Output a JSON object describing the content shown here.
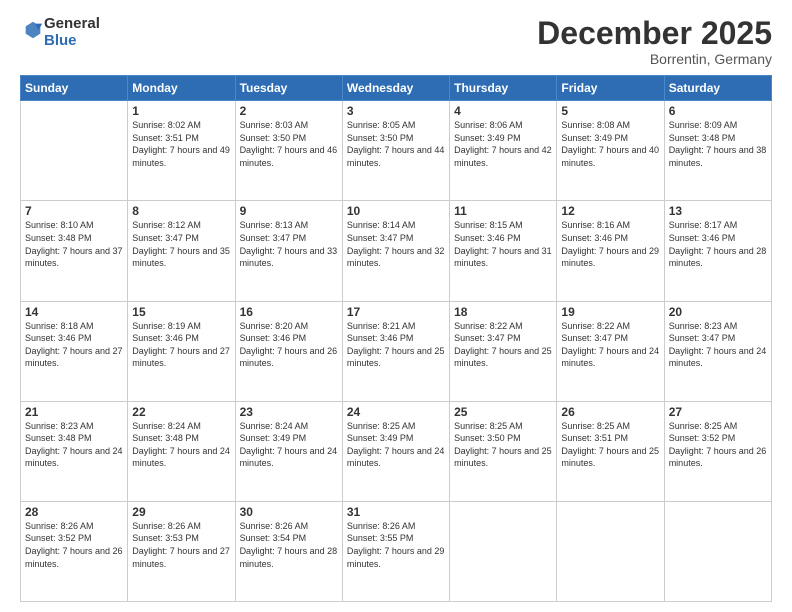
{
  "logo": {
    "general": "General",
    "blue": "Blue"
  },
  "header": {
    "month": "December 2025",
    "location": "Borrentin, Germany"
  },
  "weekdays": [
    "Sunday",
    "Monday",
    "Tuesday",
    "Wednesday",
    "Thursday",
    "Friday",
    "Saturday"
  ],
  "weeks": [
    [
      {
        "day": "",
        "sunrise": "",
        "sunset": "",
        "daylight": ""
      },
      {
        "day": "1",
        "sunrise": "Sunrise: 8:02 AM",
        "sunset": "Sunset: 3:51 PM",
        "daylight": "Daylight: 7 hours and 49 minutes."
      },
      {
        "day": "2",
        "sunrise": "Sunrise: 8:03 AM",
        "sunset": "Sunset: 3:50 PM",
        "daylight": "Daylight: 7 hours and 46 minutes."
      },
      {
        "day": "3",
        "sunrise": "Sunrise: 8:05 AM",
        "sunset": "Sunset: 3:50 PM",
        "daylight": "Daylight: 7 hours and 44 minutes."
      },
      {
        "day": "4",
        "sunrise": "Sunrise: 8:06 AM",
        "sunset": "Sunset: 3:49 PM",
        "daylight": "Daylight: 7 hours and 42 minutes."
      },
      {
        "day": "5",
        "sunrise": "Sunrise: 8:08 AM",
        "sunset": "Sunset: 3:49 PM",
        "daylight": "Daylight: 7 hours and 40 minutes."
      },
      {
        "day": "6",
        "sunrise": "Sunrise: 8:09 AM",
        "sunset": "Sunset: 3:48 PM",
        "daylight": "Daylight: 7 hours and 38 minutes."
      }
    ],
    [
      {
        "day": "7",
        "sunrise": "Sunrise: 8:10 AM",
        "sunset": "Sunset: 3:48 PM",
        "daylight": "Daylight: 7 hours and 37 minutes."
      },
      {
        "day": "8",
        "sunrise": "Sunrise: 8:12 AM",
        "sunset": "Sunset: 3:47 PM",
        "daylight": "Daylight: 7 hours and 35 minutes."
      },
      {
        "day": "9",
        "sunrise": "Sunrise: 8:13 AM",
        "sunset": "Sunset: 3:47 PM",
        "daylight": "Daylight: 7 hours and 33 minutes."
      },
      {
        "day": "10",
        "sunrise": "Sunrise: 8:14 AM",
        "sunset": "Sunset: 3:47 PM",
        "daylight": "Daylight: 7 hours and 32 minutes."
      },
      {
        "day": "11",
        "sunrise": "Sunrise: 8:15 AM",
        "sunset": "Sunset: 3:46 PM",
        "daylight": "Daylight: 7 hours and 31 minutes."
      },
      {
        "day": "12",
        "sunrise": "Sunrise: 8:16 AM",
        "sunset": "Sunset: 3:46 PM",
        "daylight": "Daylight: 7 hours and 29 minutes."
      },
      {
        "day": "13",
        "sunrise": "Sunrise: 8:17 AM",
        "sunset": "Sunset: 3:46 PM",
        "daylight": "Daylight: 7 hours and 28 minutes."
      }
    ],
    [
      {
        "day": "14",
        "sunrise": "Sunrise: 8:18 AM",
        "sunset": "Sunset: 3:46 PM",
        "daylight": "Daylight: 7 hours and 27 minutes."
      },
      {
        "day": "15",
        "sunrise": "Sunrise: 8:19 AM",
        "sunset": "Sunset: 3:46 PM",
        "daylight": "Daylight: 7 hours and 27 minutes."
      },
      {
        "day": "16",
        "sunrise": "Sunrise: 8:20 AM",
        "sunset": "Sunset: 3:46 PM",
        "daylight": "Daylight: 7 hours and 26 minutes."
      },
      {
        "day": "17",
        "sunrise": "Sunrise: 8:21 AM",
        "sunset": "Sunset: 3:46 PM",
        "daylight": "Daylight: 7 hours and 25 minutes."
      },
      {
        "day": "18",
        "sunrise": "Sunrise: 8:22 AM",
        "sunset": "Sunset: 3:47 PM",
        "daylight": "Daylight: 7 hours and 25 minutes."
      },
      {
        "day": "19",
        "sunrise": "Sunrise: 8:22 AM",
        "sunset": "Sunset: 3:47 PM",
        "daylight": "Daylight: 7 hours and 24 minutes."
      },
      {
        "day": "20",
        "sunrise": "Sunrise: 8:23 AM",
        "sunset": "Sunset: 3:47 PM",
        "daylight": "Daylight: 7 hours and 24 minutes."
      }
    ],
    [
      {
        "day": "21",
        "sunrise": "Sunrise: 8:23 AM",
        "sunset": "Sunset: 3:48 PM",
        "daylight": "Daylight: 7 hours and 24 minutes."
      },
      {
        "day": "22",
        "sunrise": "Sunrise: 8:24 AM",
        "sunset": "Sunset: 3:48 PM",
        "daylight": "Daylight: 7 hours and 24 minutes."
      },
      {
        "day": "23",
        "sunrise": "Sunrise: 8:24 AM",
        "sunset": "Sunset: 3:49 PM",
        "daylight": "Daylight: 7 hours and 24 minutes."
      },
      {
        "day": "24",
        "sunrise": "Sunrise: 8:25 AM",
        "sunset": "Sunset: 3:49 PM",
        "daylight": "Daylight: 7 hours and 24 minutes."
      },
      {
        "day": "25",
        "sunrise": "Sunrise: 8:25 AM",
        "sunset": "Sunset: 3:50 PM",
        "daylight": "Daylight: 7 hours and 25 minutes."
      },
      {
        "day": "26",
        "sunrise": "Sunrise: 8:25 AM",
        "sunset": "Sunset: 3:51 PM",
        "daylight": "Daylight: 7 hours and 25 minutes."
      },
      {
        "day": "27",
        "sunrise": "Sunrise: 8:25 AM",
        "sunset": "Sunset: 3:52 PM",
        "daylight": "Daylight: 7 hours and 26 minutes."
      }
    ],
    [
      {
        "day": "28",
        "sunrise": "Sunrise: 8:26 AM",
        "sunset": "Sunset: 3:52 PM",
        "daylight": "Daylight: 7 hours and 26 minutes."
      },
      {
        "day": "29",
        "sunrise": "Sunrise: 8:26 AM",
        "sunset": "Sunset: 3:53 PM",
        "daylight": "Daylight: 7 hours and 27 minutes."
      },
      {
        "day": "30",
        "sunrise": "Sunrise: 8:26 AM",
        "sunset": "Sunset: 3:54 PM",
        "daylight": "Daylight: 7 hours and 28 minutes."
      },
      {
        "day": "31",
        "sunrise": "Sunrise: 8:26 AM",
        "sunset": "Sunset: 3:55 PM",
        "daylight": "Daylight: 7 hours and 29 minutes."
      },
      {
        "day": "",
        "sunrise": "",
        "sunset": "",
        "daylight": ""
      },
      {
        "day": "",
        "sunrise": "",
        "sunset": "",
        "daylight": ""
      },
      {
        "day": "",
        "sunrise": "",
        "sunset": "",
        "daylight": ""
      }
    ]
  ]
}
